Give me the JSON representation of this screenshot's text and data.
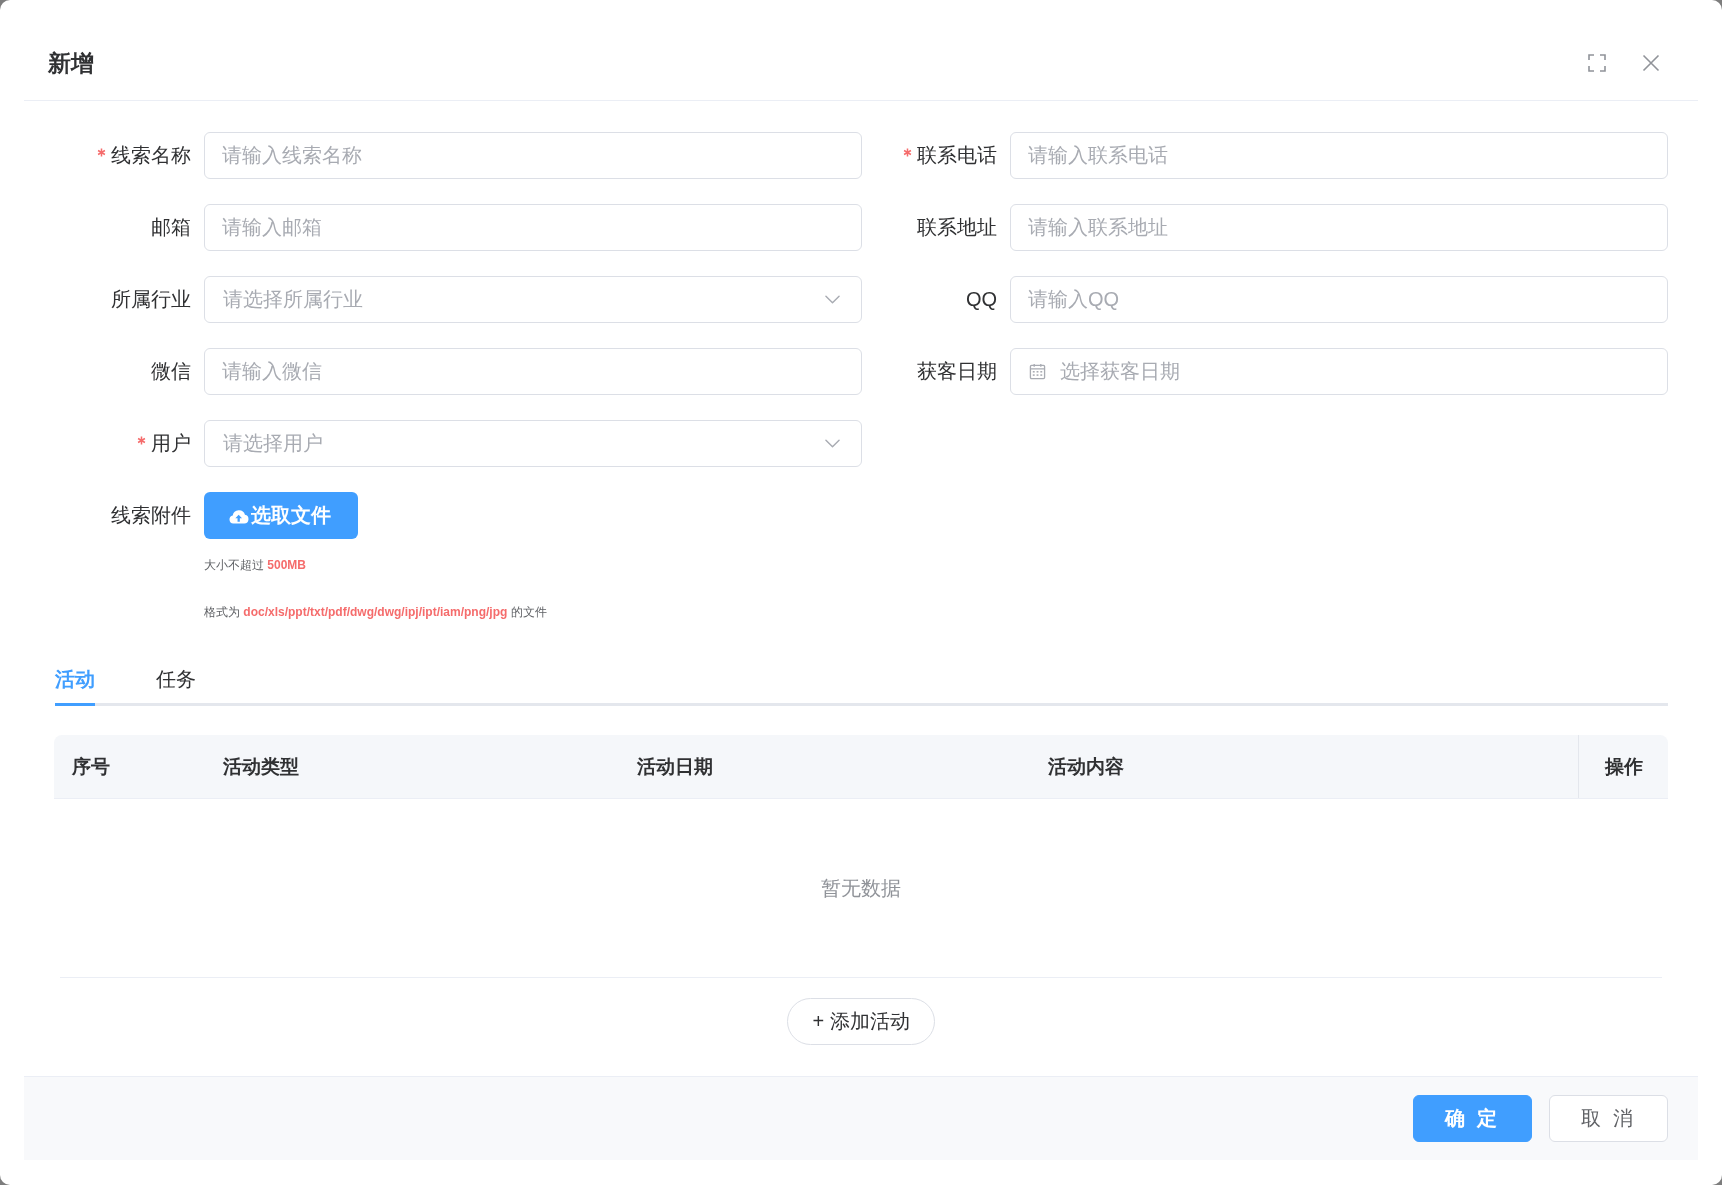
{
  "dialog": {
    "title": "新增"
  },
  "form": {
    "fields": [
      {
        "kind": "input",
        "label": "线索名称",
        "required": true,
        "placeholder": "请输入线索名称"
      },
      {
        "kind": "input",
        "label": "联系电话",
        "required": true,
        "placeholder": "请输入联系电话"
      },
      {
        "kind": "input",
        "label": "邮箱",
        "required": false,
        "placeholder": "请输入邮箱"
      },
      {
        "kind": "input",
        "label": "联系地址",
        "required": false,
        "placeholder": "请输入联系地址"
      },
      {
        "kind": "select",
        "label": "所属行业",
        "required": false,
        "placeholder": "请选择所属行业"
      },
      {
        "kind": "input",
        "label": "QQ",
        "required": false,
        "placeholder": "请输入QQ"
      },
      {
        "kind": "input",
        "label": "微信",
        "required": false,
        "placeholder": "请输入微信"
      },
      {
        "kind": "date",
        "label": "获客日期",
        "required": false,
        "placeholder": "选择获客日期"
      },
      {
        "kind": "select",
        "label": "用户",
        "required": true,
        "placeholder": "请选择用户"
      },
      {
        "kind": "upload",
        "label": "线索附件",
        "required": false,
        "button": "选取文件",
        "tips": [
          "大小不超过 **500MB**",
          "格式为 **doc/xls/ppt/txt/pdf/dwg/dwg/ipj/ipt/iam/png/jpg** 的文件"
        ]
      }
    ]
  },
  "tabs": [
    {
      "label": "活动",
      "selected": true
    },
    {
      "label": "任务",
      "selected": false
    }
  ],
  "table": {
    "columns": [
      "序号",
      "活动类型",
      "活动日期",
      "活动内容",
      "操作"
    ],
    "empty_text": "暂无数据"
  },
  "add_button": "+ 添加活动",
  "footer": {
    "buttons": [
      {
        "kind": "primary",
        "label": "确 定"
      },
      {
        "kind": "default",
        "label": "取 消"
      }
    ]
  }
}
